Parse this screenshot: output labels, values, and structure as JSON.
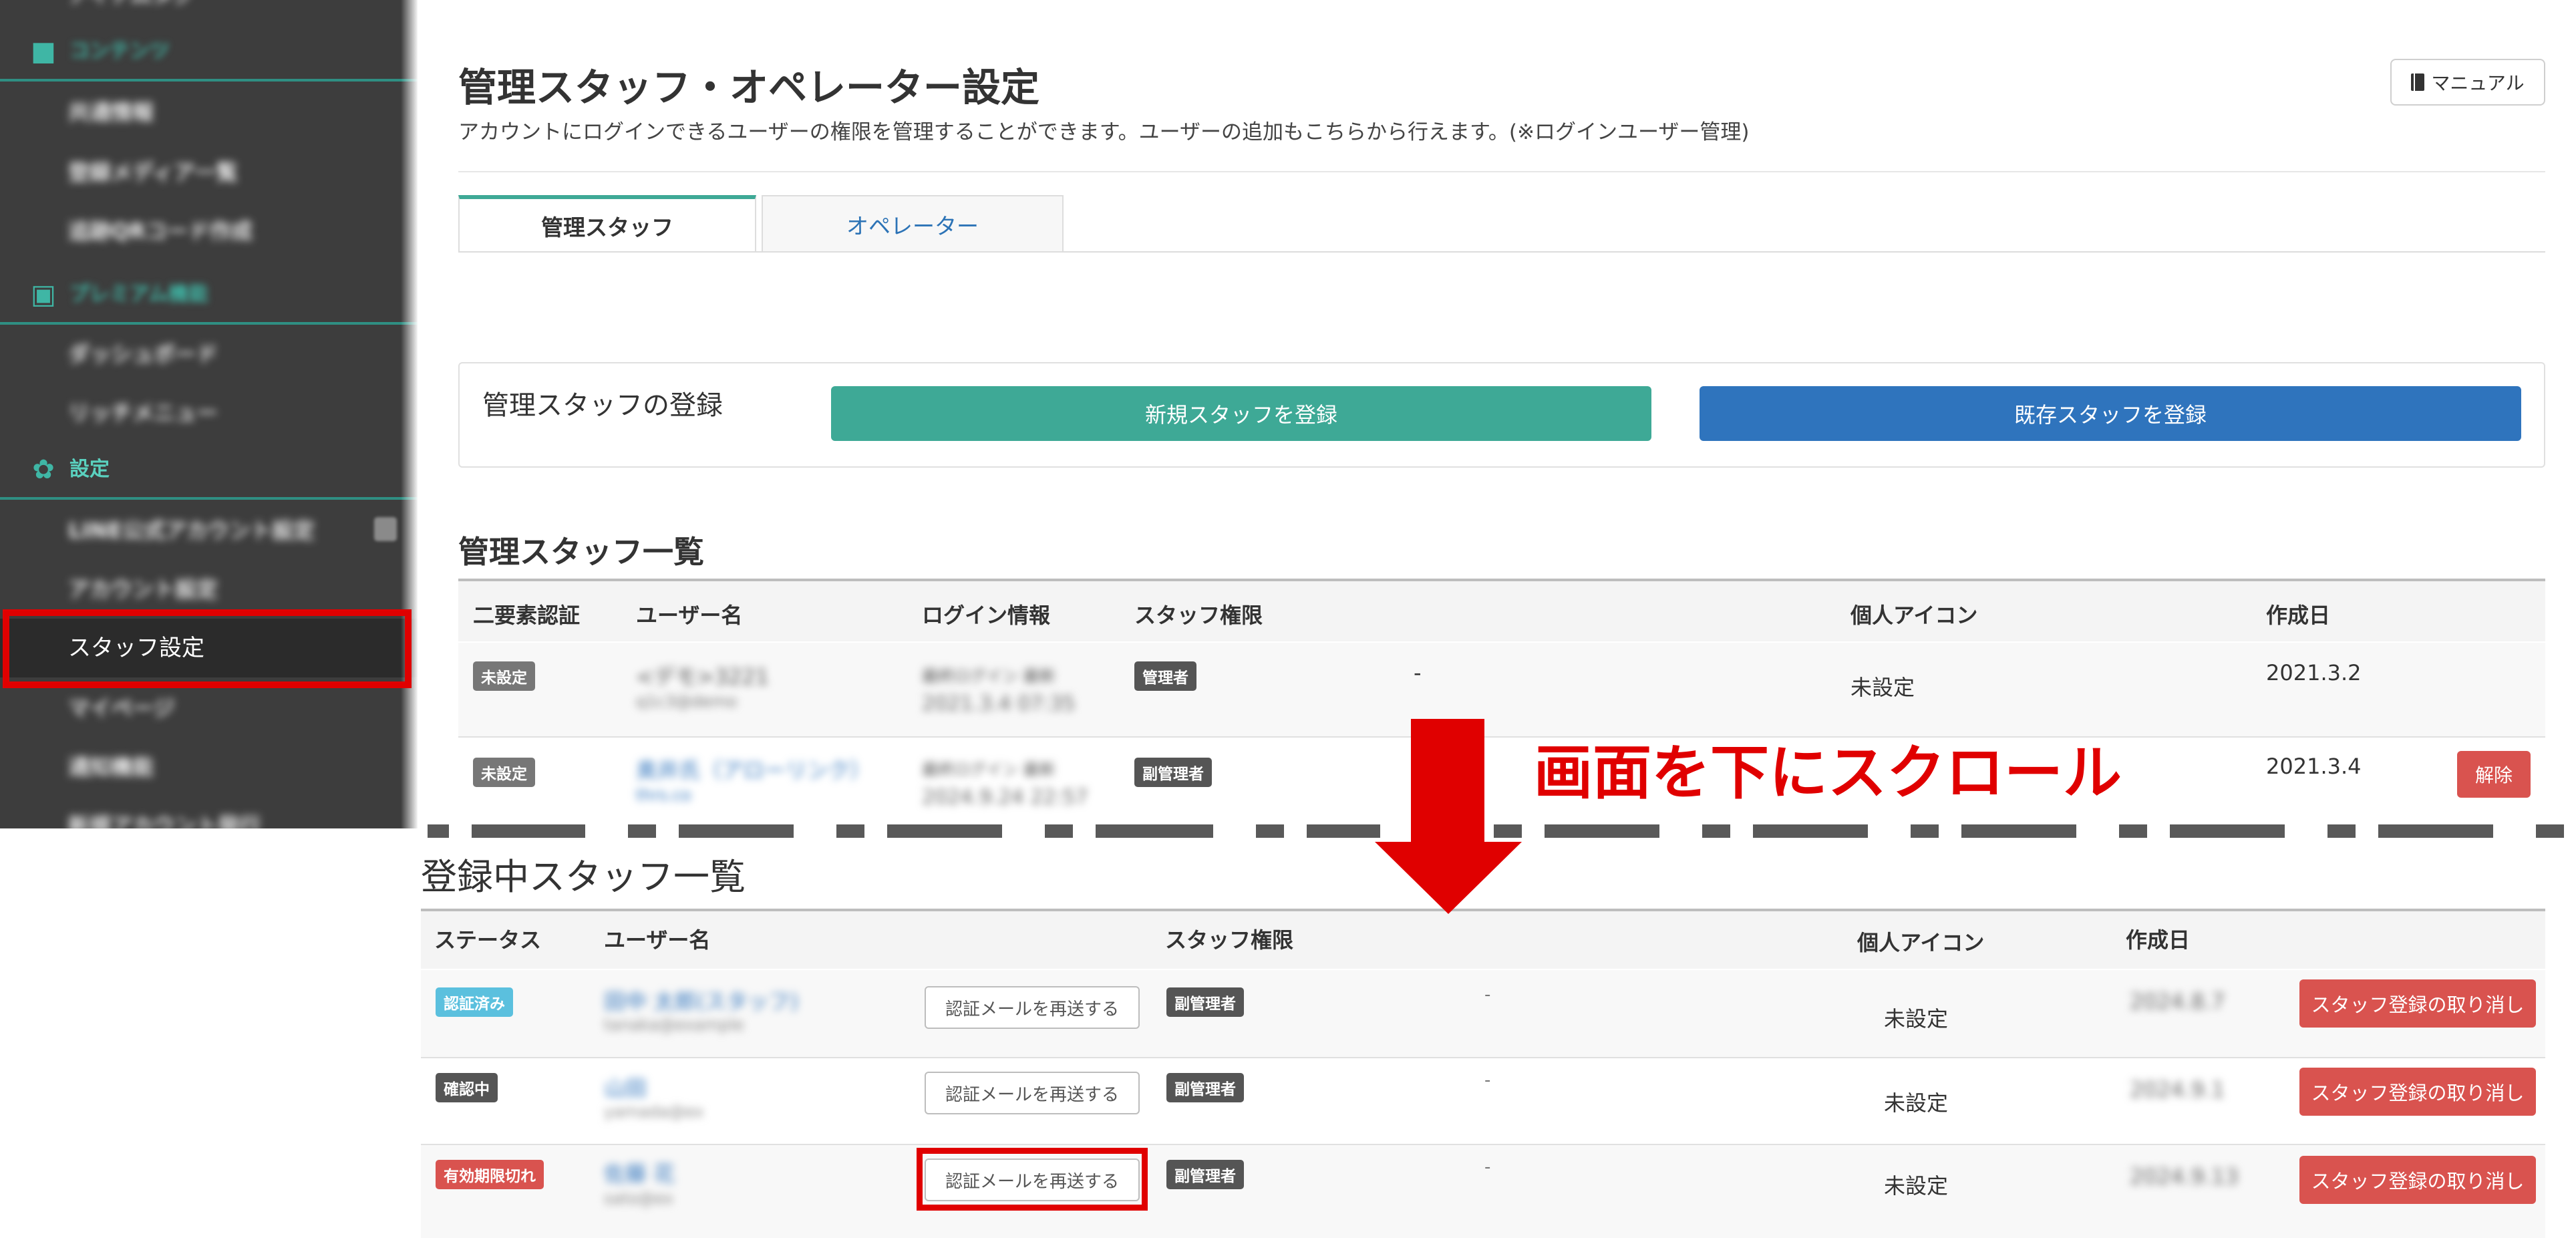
{
  "sidebar": {
    "sections": [
      {
        "label": "コンテンツ"
      },
      {
        "label": "プレミアム機能"
      },
      {
        "label": "設定"
      }
    ],
    "items": [
      {
        "label": "アイテムタグ"
      },
      {
        "label": "共通情報"
      },
      {
        "label": "登録メディア一覧"
      },
      {
        "label": "追跡QRコード作成"
      },
      {
        "label": "ダッシュボード"
      },
      {
        "label": "リッチメニュー"
      },
      {
        "label": "LINE公式アカウント設定"
      },
      {
        "label": "アカウント設定"
      },
      {
        "label": "スタッフ設定"
      },
      {
        "label": "マイページ"
      },
      {
        "label": "通知機能"
      },
      {
        "label": "新規アカウント発行"
      }
    ]
  },
  "header": {
    "title": "管理スタッフ・オペレーター設定",
    "subtitle": "アカウントにログインできるユーザーの権限を管理することができます。ユーザーの追加もこちらから行えます。(※ログインユーザー管理)",
    "manual_label": "マニュアル"
  },
  "tabs": [
    {
      "label": "管理スタッフ"
    },
    {
      "label": "オペレーター"
    }
  ],
  "register": {
    "label": "管理スタッフの登録",
    "new_button": "新規スタッフを登録",
    "existing_button": "既存スタッフを登録"
  },
  "admin_list": {
    "title": "管理スタッフ一覧",
    "headers": [
      "二要素認証",
      "ユーザー名",
      "ログイン情報",
      "スタッフ権限",
      "個人アイコン",
      "作成日"
    ],
    "rows": [
      {
        "two_factor": "未設定",
        "name": "<デモ>3221",
        "email": "q1c3@demo",
        "login_label": "最終ログイン 最新",
        "login_date": "2021.3.4 07:35",
        "role": "管理者",
        "dash": "-",
        "icon": "未設定",
        "created": "2021.3.2"
      },
      {
        "two_factor": "未設定",
        "name": "奥井氏（アローリンク）",
        "email": "thrs.co",
        "login_label": "最終ログイン 最新",
        "login_date": "2024.9.24 22:57",
        "role": "副管理者",
        "dash": "-",
        "icon": "",
        "created": "2021.3.4",
        "action": "解除"
      }
    ]
  },
  "scroll_note": "画面を下にスクロール",
  "registered_list": {
    "title": "登録中スタッフ一覧",
    "headers": [
      "ステータス",
      "ユーザー名",
      "スタッフ権限",
      "個人アイコン",
      "作成日"
    ],
    "resend_label": "認証メールを再送する",
    "cancel_label": "スタッフ登録の取り消し",
    "rows": [
      {
        "status": "認証済み",
        "name": "田中 太郎(スタッフ)",
        "email": "tanaka@example",
        "role": "副管理者",
        "dash": "-",
        "icon": "未設定",
        "created": "2024.8.7"
      },
      {
        "status": "確認中",
        "name": "山田",
        "email": "yamada@ex",
        "role": "副管理者",
        "dash": "-",
        "icon": "未設定",
        "created": "2024.9.1"
      },
      {
        "status": "有効期限切れ",
        "name": "佐藤 花",
        "email": "sato@ex",
        "role": "副管理者",
        "dash": "-",
        "icon": "未設定",
        "created": "2024.9.13"
      }
    ]
  },
  "colors": {
    "accent": "#3ea996",
    "primary": "#2f74bd",
    "danger": "#d9534f",
    "highlight": "#e00000"
  }
}
